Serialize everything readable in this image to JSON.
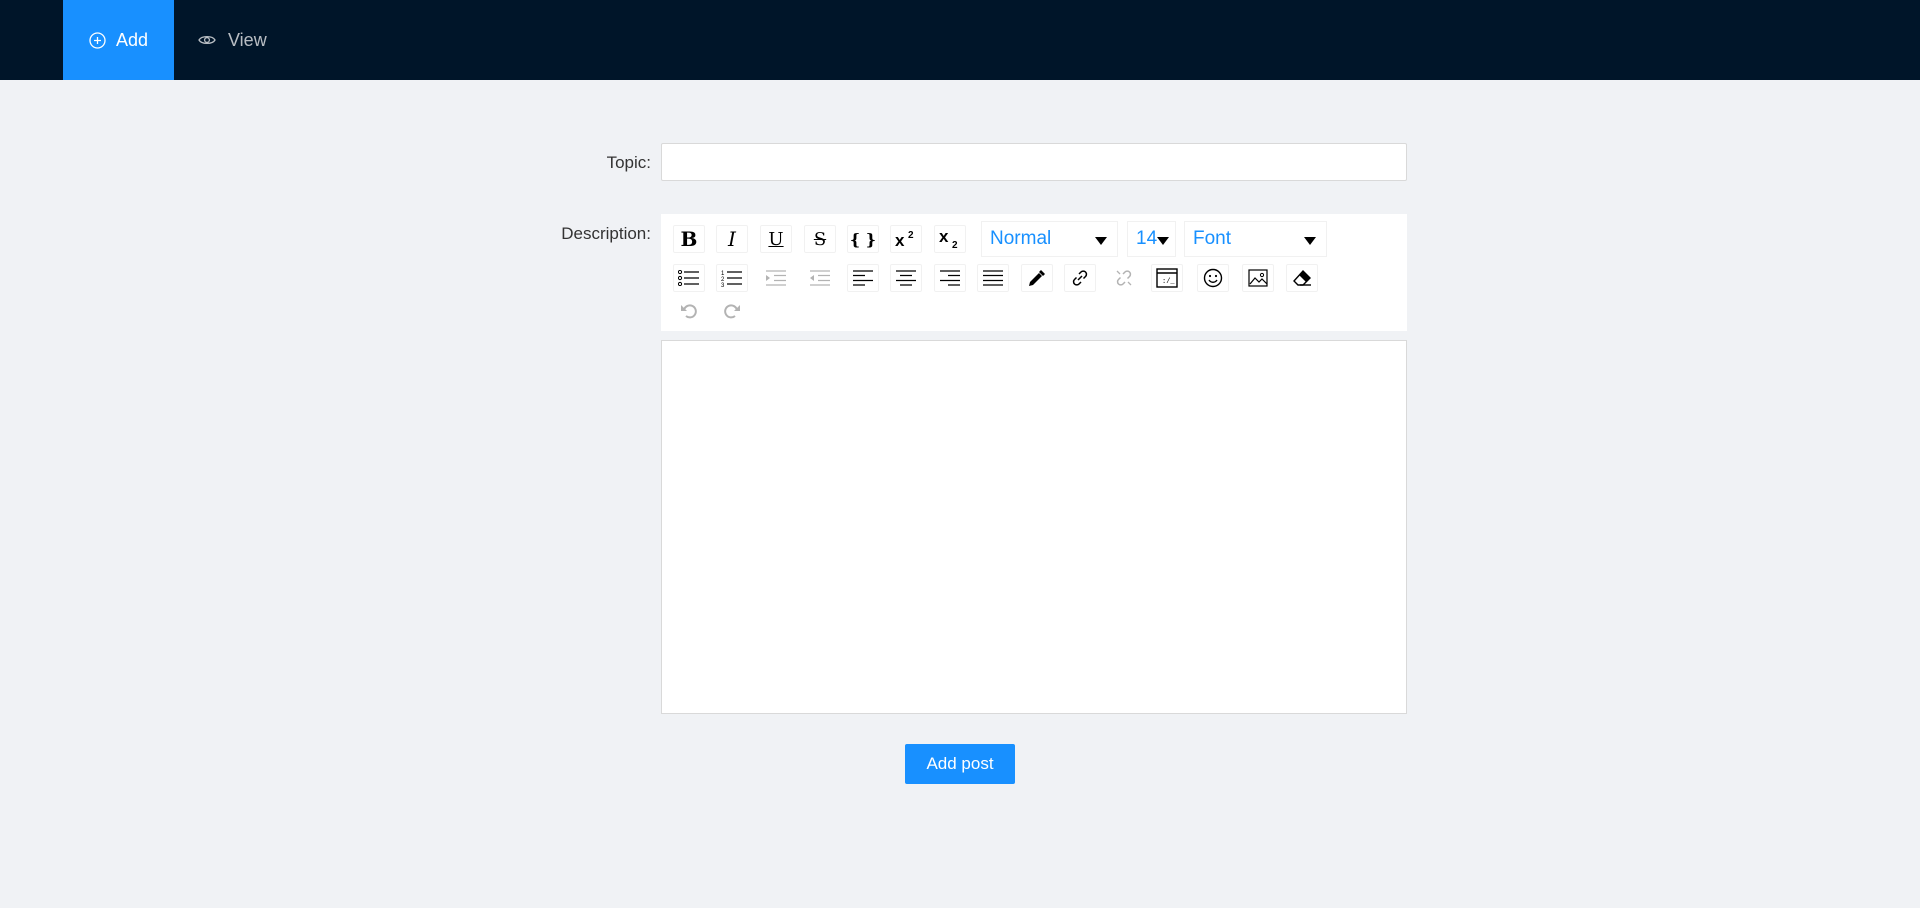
{
  "nav": {
    "add_label": "Add",
    "view_label": "View",
    "active_color": "#1890ff",
    "bar_color": "#001529"
  },
  "form": {
    "topic_label": "Topic",
    "description_label": "Description",
    "topic_value": "",
    "submit_label": "Add post"
  },
  "toolbar": {
    "block_type": "Normal",
    "font_size": "14",
    "font_family": "Font",
    "icons": [
      "bold-icon",
      "italic-icon",
      "underline-icon",
      "strikethrough-icon",
      "code-icon",
      "superscript-icon",
      "subscript-icon",
      "unordered-list-icon",
      "ordered-list-icon",
      "indent-icon",
      "outdent-icon",
      "align-left-icon",
      "align-center-icon",
      "align-right-icon",
      "align-justify-icon",
      "color-picker-icon",
      "link-icon",
      "unlink-icon",
      "embedded-icon",
      "emoji-icon",
      "image-icon",
      "eraser-icon",
      "undo-icon",
      "redo-icon"
    ]
  }
}
